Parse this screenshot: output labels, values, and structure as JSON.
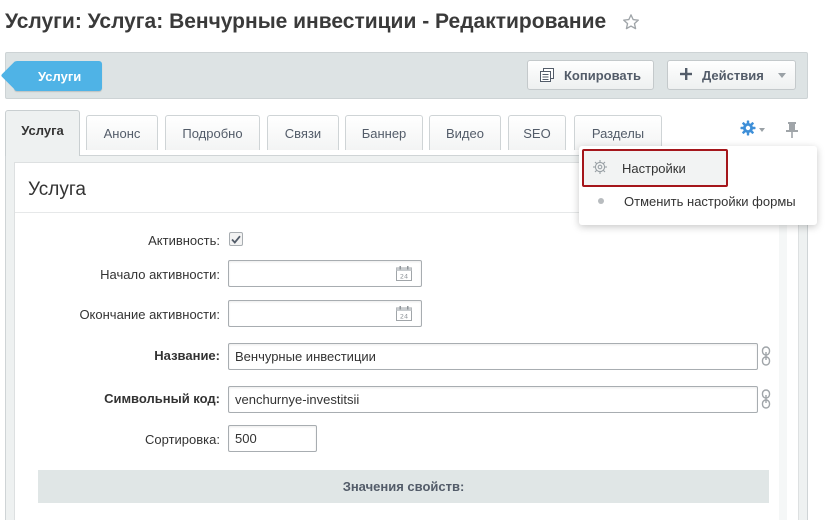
{
  "header": {
    "title": "Услуги: Услуга: Венчурные инвестиции - Редактирование"
  },
  "toolbar": {
    "back_label": "Услуги",
    "copy_label": "Копировать",
    "actions_label": "Действия"
  },
  "tabs": [
    {
      "label": "Услуга",
      "active": true
    },
    {
      "label": "Анонс"
    },
    {
      "label": "Подробно"
    },
    {
      "label": "Связи"
    },
    {
      "label": "Баннер"
    },
    {
      "label": "Видео"
    },
    {
      "label": "SEO"
    },
    {
      "label": "Разделы"
    }
  ],
  "settings_menu": {
    "items": [
      {
        "label": "Настройки",
        "icon": "gear-icon"
      },
      {
        "label": "Отменить настройки формы"
      }
    ]
  },
  "section": {
    "title": "Услуга"
  },
  "form": {
    "active_label": "Активность:",
    "active_checked": true,
    "start_label": "Начало активности:",
    "start_value": "",
    "end_label": "Окончание активности:",
    "end_value": "",
    "name_label": "Название:",
    "name_value": "Венчурные инвестиции",
    "code_label": "Символьный код:",
    "code_value": "venchurnye-investitsii",
    "sort_label": "Сортировка:",
    "sort_value": "500",
    "props_title": "Значения свойств:"
  },
  "colors": {
    "accent": "#4fb3e6",
    "highlight_border": "#a5161b",
    "gear": "#3e8fd8"
  }
}
